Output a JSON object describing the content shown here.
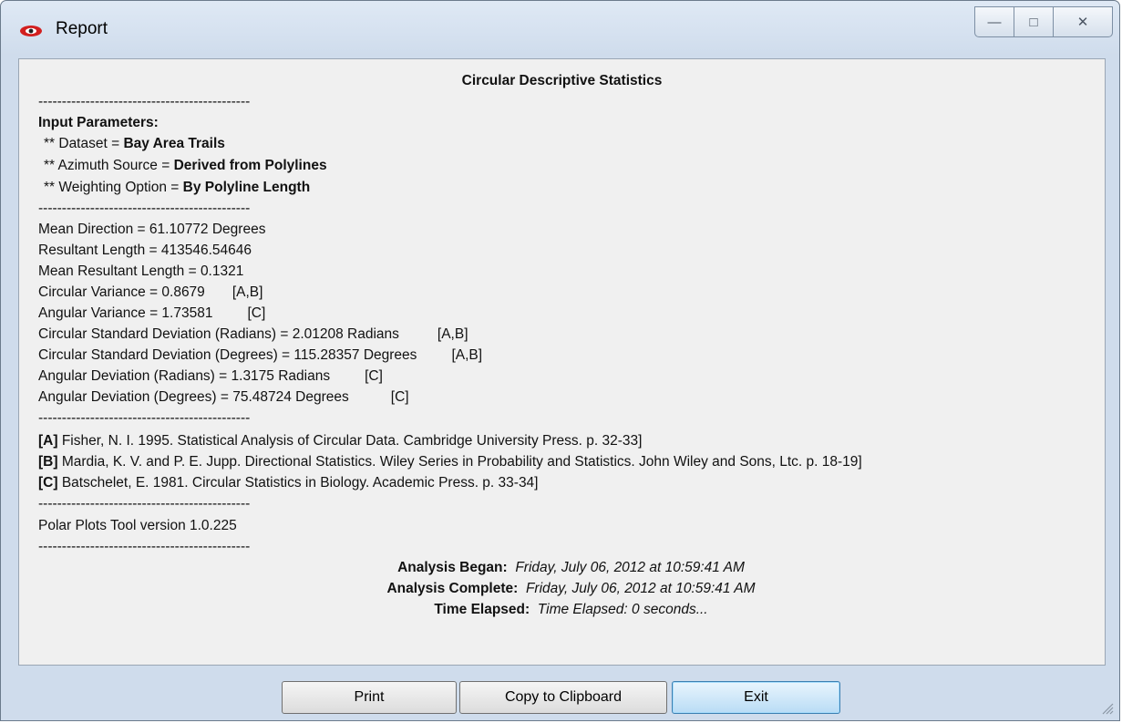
{
  "window": {
    "title": "Report",
    "controls": {
      "minimize": "—",
      "maximize": "□",
      "close": "✕"
    }
  },
  "report": {
    "heading": "Circular Descriptive Statistics",
    "divider": "---------------------------------------------",
    "input_header": "Input Parameters:",
    "params": [
      {
        "label": "** Dataset = ",
        "value": "Bay Area Trails"
      },
      {
        "label": "** Azimuth Source = ",
        "value": "Derived from Polylines"
      },
      {
        "label": "** Weighting Option = ",
        "value": "By Polyline Length"
      }
    ],
    "stats": [
      {
        "text": "Mean Direction = 61.10772 Degrees",
        "ref": ""
      },
      {
        "text": "Resultant Length = 413546.54646",
        "ref": ""
      },
      {
        "text": "Mean Resultant Length = 0.1321",
        "ref": ""
      },
      {
        "text": "Circular Variance = 0.8679",
        "ref": "[A,B]"
      },
      {
        "text": "Angular Variance = 1.73581",
        "ref": "[C]"
      },
      {
        "text": "Circular Standard Deviation (Radians) = 2.01208 Radians",
        "ref": "[A,B]"
      },
      {
        "text": "Circular Standard Deviation (Degrees) = 115.28357 Degrees",
        "ref": "[A,B]"
      },
      {
        "text": "Angular Deviation (Radians) = 1.3175 Radians",
        "ref": "[C]"
      },
      {
        "text": "Angular Deviation (Degrees) = 75.48724 Degrees",
        "ref": "[C]"
      }
    ],
    "references": [
      {
        "tag": "[A]",
        "text": " Fisher, N. I.  1995.  Statistical Analysis of Circular Data.  Cambridge University Press. p. 32-33]"
      },
      {
        "tag": "[B]",
        "text": " Mardia, K. V. and P. E. Jupp.  Directional Statistics.  Wiley Series in Probability and Statistics.  John Wiley and Sons, Ltc. p. 18-19]"
      },
      {
        "tag": "[C]",
        "text": " Batschelet, E.  1981.  Circular Statistics in Biology.  Academic Press. p. 33-34]"
      }
    ],
    "version": "Polar Plots Tool version 1.0.225",
    "timing": [
      {
        "label": "Analysis Began:",
        "value": "Friday, July 06, 2012 at 10:59:41 AM"
      },
      {
        "label": "Analysis Complete:",
        "value": "Friday, July 06, 2012 at 10:59:41 AM"
      },
      {
        "label": "Time Elapsed:",
        "value": "Time Elapsed: 0 seconds..."
      }
    ]
  },
  "buttons": {
    "print": "Print",
    "copy": "Copy to Clipboard",
    "exit": "Exit"
  }
}
